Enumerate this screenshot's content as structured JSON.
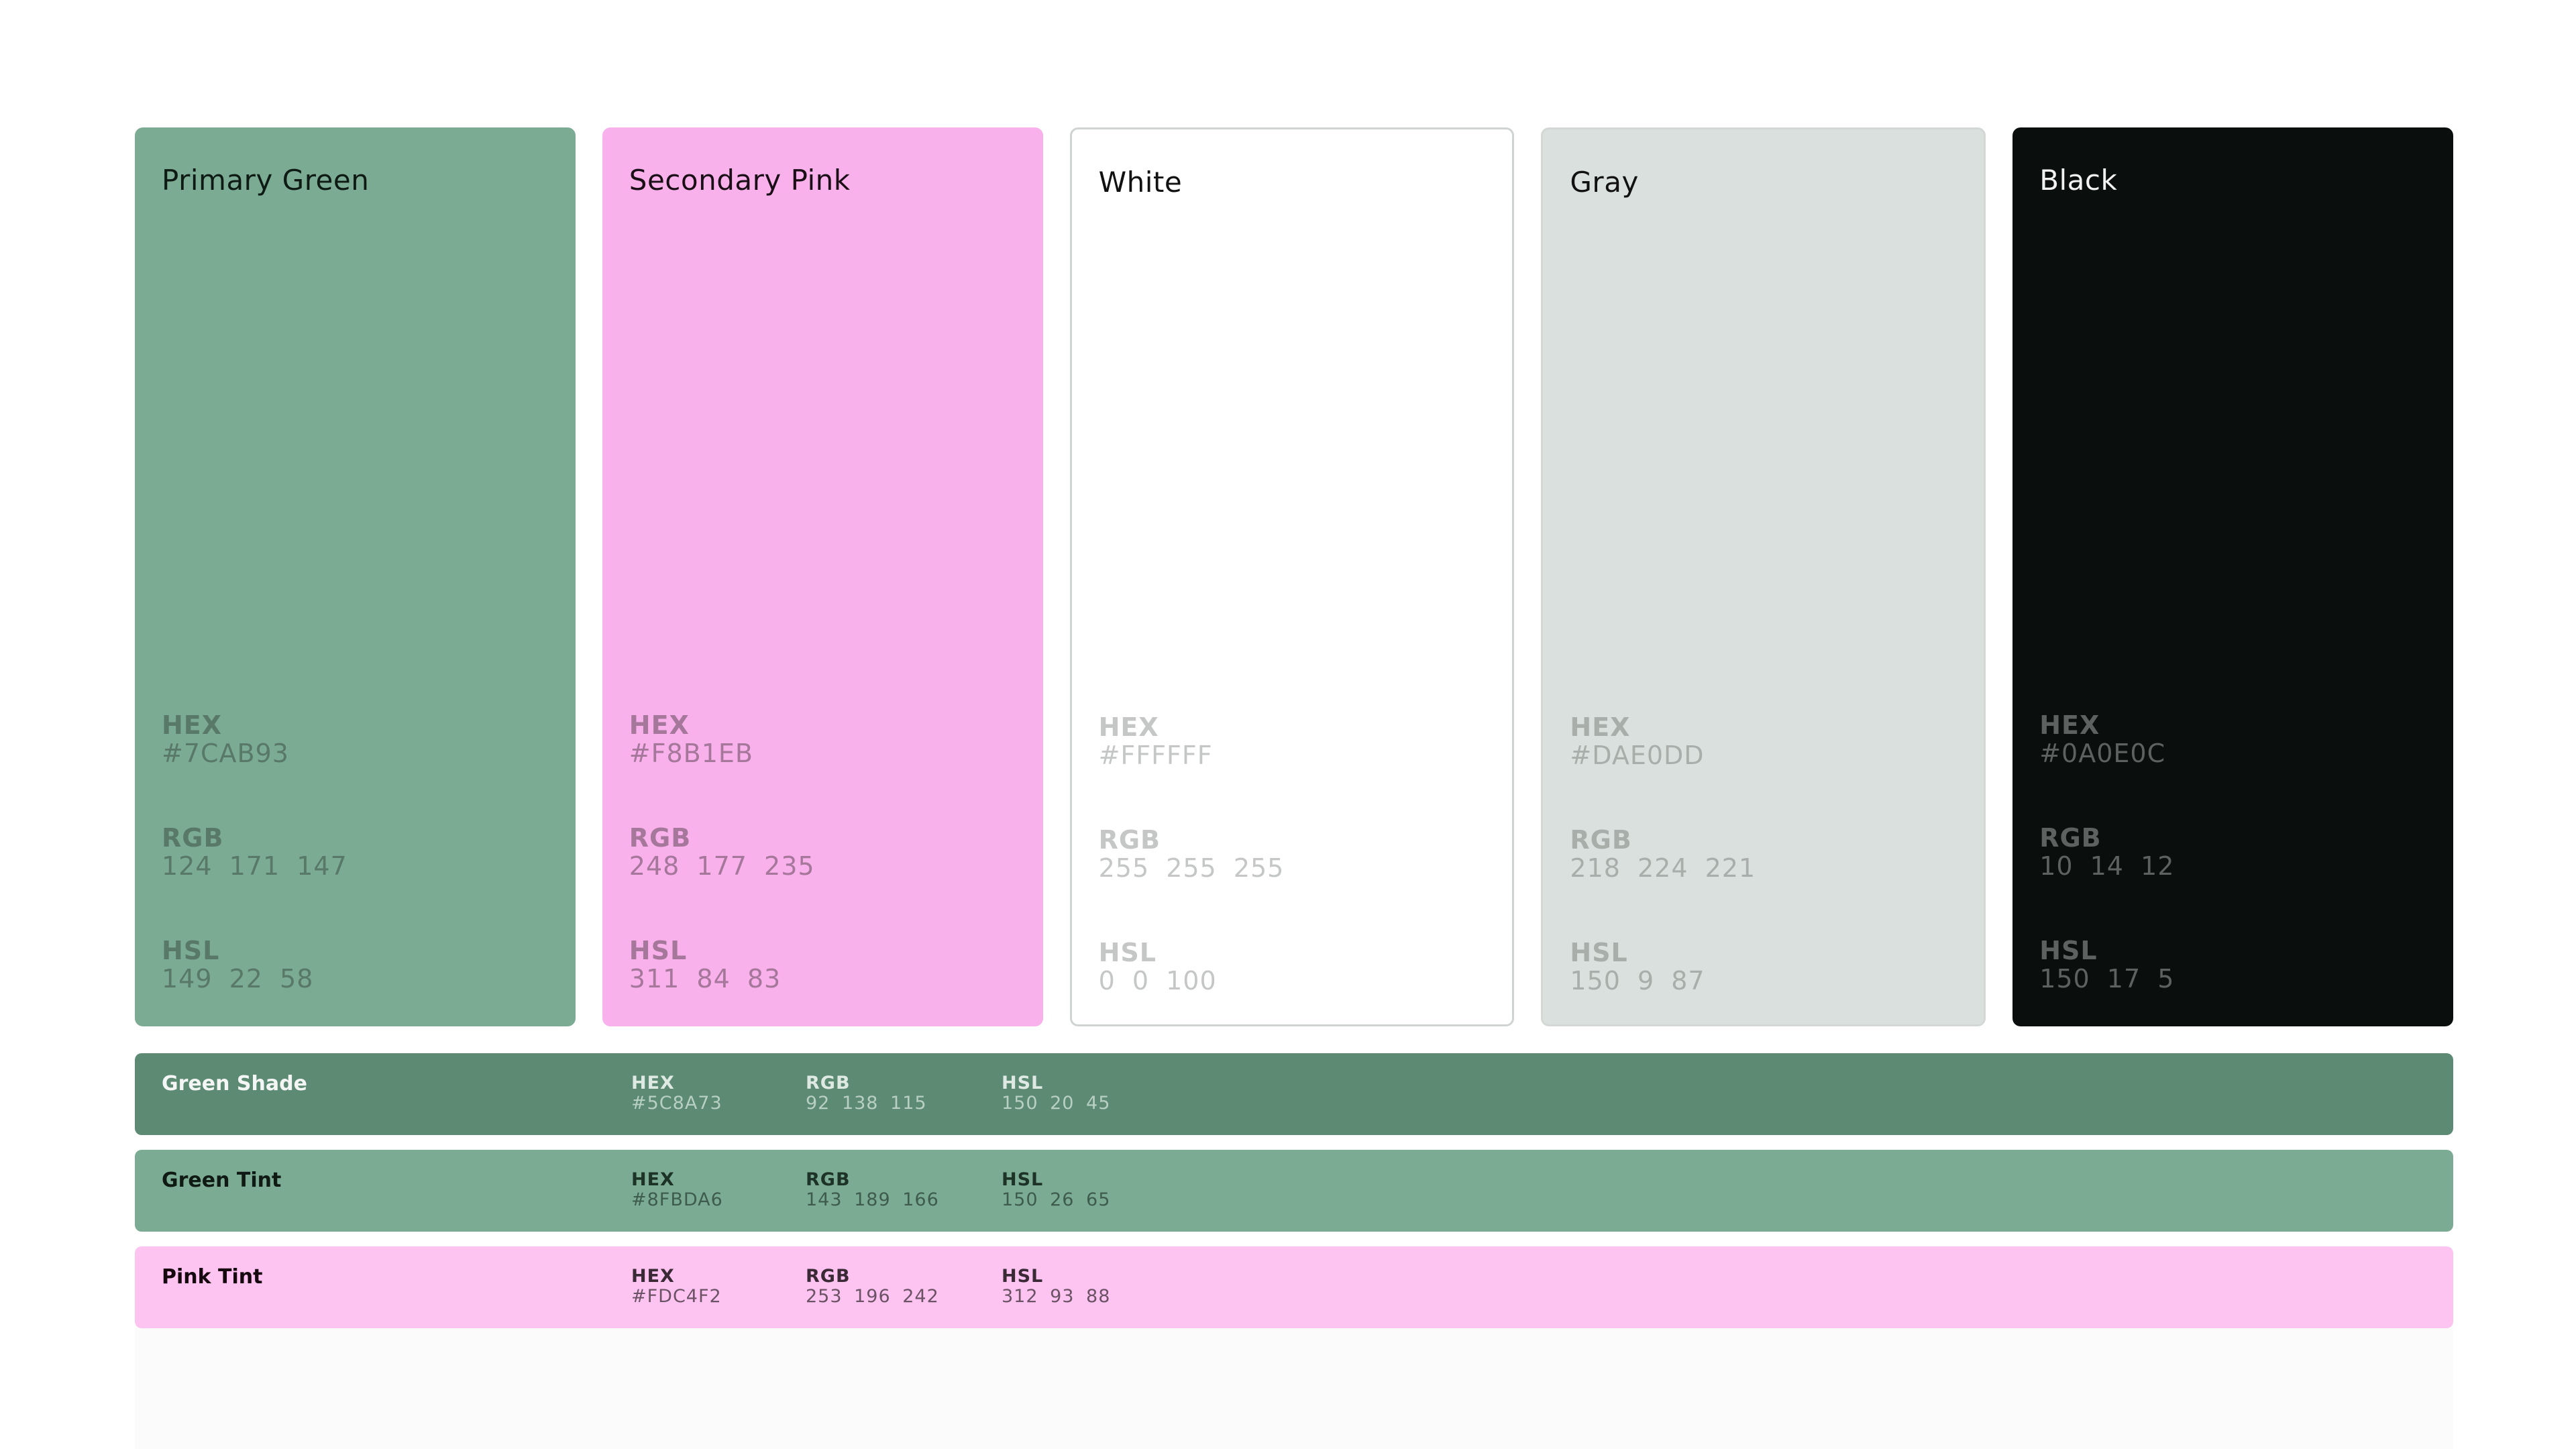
{
  "colors": {
    "primary_green": "#7CAB93",
    "secondary_pink": "#F8B1EB",
    "white": "#FFFFFF",
    "gray": "#DAE0DD",
    "black": "#0A0E0C",
    "green_shade": "#5C8A73",
    "green_tint": "#8FBDA6",
    "pink_tint": "#FDC4F2"
  },
  "cards": [
    {
      "title": "Primary Green",
      "hex_label": "HEX",
      "hex": "#7CAB93",
      "rgb_label": "RGB",
      "rgb": "124  171  147",
      "hsl_label": "HSL",
      "hsl": "149  22  58"
    },
    {
      "title": "Secondary Pink",
      "hex_label": "HEX",
      "hex": "#F8B1EB",
      "rgb_label": "RGB",
      "rgb": "248  177  235",
      "hsl_label": "HSL",
      "hsl": "311  84  83"
    },
    {
      "title": "White",
      "hex_label": "HEX",
      "hex": "#FFFFFF",
      "rgb_label": "RGB",
      "rgb": "255  255  255",
      "hsl_label": "HSL",
      "hsl": "0  0  100"
    },
    {
      "title": "Gray",
      "hex_label": "HEX",
      "hex": "#DAE0DD",
      "rgb_label": "RGB",
      "rgb": "218  224  221",
      "hsl_label": "HSL",
      "hsl": "150  9  87"
    },
    {
      "title": "Black",
      "hex_label": "HEX",
      "hex": "#0A0E0C",
      "rgb_label": "RGB",
      "rgb": "10  14  12",
      "hsl_label": "HSL",
      "hsl": "150  17  5"
    }
  ],
  "strips": [
    {
      "title": "Green Shade",
      "hex_label": "HEX",
      "hex": "#5C8A73",
      "rgb_label": "RGB",
      "rgb": "92  138  115",
      "hsl_label": "HSL",
      "hsl": "150  20  45"
    },
    {
      "title": "Green Tint",
      "hex_label": "HEX",
      "hex": "#8FBDA6",
      "rgb_label": "RGB",
      "rgb": "143  189  166",
      "hsl_label": "HSL",
      "hsl": "150  26  65"
    },
    {
      "title": "Pink Tint",
      "hex_label": "HEX",
      "hex": "#FDC4F2",
      "rgb_label": "RGB",
      "rgb": "253  196  242",
      "hsl_label": "HSL",
      "hsl": "312  93  88"
    }
  ]
}
